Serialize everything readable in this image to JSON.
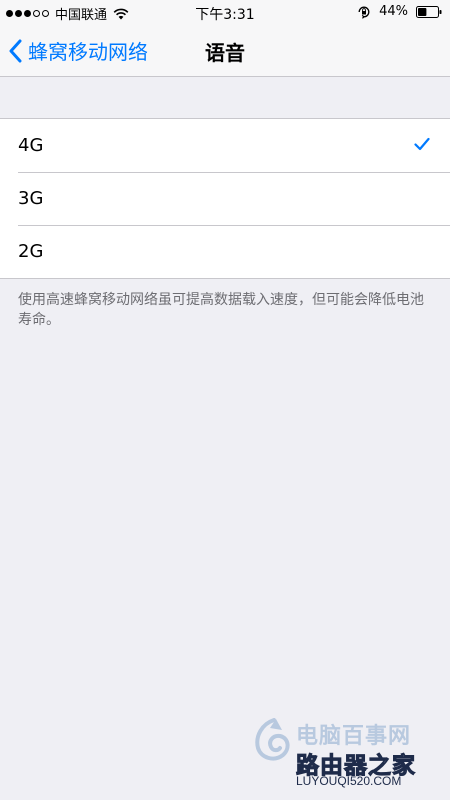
{
  "status_bar": {
    "signal_dots_filled": 3,
    "signal_dots_empty": 2,
    "carrier": "中国联通",
    "time": "下午3:31",
    "battery": "44%",
    "battery_level": 0.44,
    "icons": [
      "wifi-icon",
      "orientation-lock-icon",
      "battery-icon"
    ]
  },
  "nav": {
    "back_label": "蜂窝移动网络",
    "title": "语音",
    "back_icon": "chevron-left-icon",
    "accent_color": "#007aff"
  },
  "options": [
    {
      "label": "4G",
      "selected": true
    },
    {
      "label": "3G",
      "selected": false
    },
    {
      "label": "2G",
      "selected": false
    }
  ],
  "footer_note": "使用高速蜂窝移动网络虽可提高数据载入速度，但可能会降低电池寿命。",
  "watermark": {
    "line1": "电脑百事网",
    "line2": "路由器之家",
    "url": "LUYOUQI520.COM"
  }
}
